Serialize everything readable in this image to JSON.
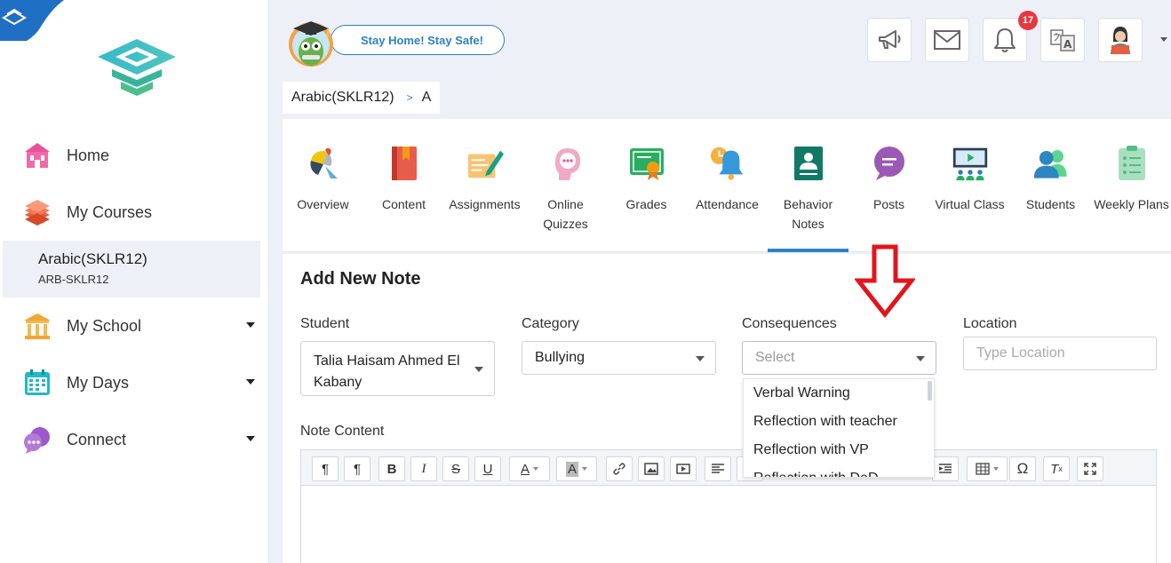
{
  "sidebar": {
    "nav": [
      {
        "label": "Home",
        "icon": "home-icon"
      },
      {
        "label": "My Courses",
        "icon": "courses-icon"
      },
      {
        "label": "My School",
        "icon": "school-icon"
      },
      {
        "label": "My Days",
        "icon": "calendar-icon"
      },
      {
        "label": "Connect",
        "icon": "connect-icon"
      }
    ],
    "active_course": {
      "name": "Arabic(SKLR12)",
      "code": "ARB-SKLR12"
    }
  },
  "header": {
    "banner": "Stay Home! Stay Safe!",
    "notification_count": "17"
  },
  "breadcrumb": {
    "course": "Arabic(SKLR12)",
    "separator": ">",
    "section": "A"
  },
  "tabs": [
    {
      "label": "Overview",
      "icon": "overview-icon"
    },
    {
      "label": "Content",
      "icon": "book-icon"
    },
    {
      "label": "Assignments",
      "icon": "assignment-icon"
    },
    {
      "label": "Online\nQuizzes",
      "icon": "quiz-icon"
    },
    {
      "label": "Grades",
      "icon": "certificate-icon"
    },
    {
      "label": "Attendance",
      "icon": "bell-clock-icon"
    },
    {
      "label": "Behavior\nNotes",
      "icon": "behavior-icon",
      "active": true
    },
    {
      "label": "Posts",
      "icon": "chat-icon"
    },
    {
      "label": "Virtual Class",
      "icon": "virtual-class-icon"
    },
    {
      "label": "Students",
      "icon": "students-icon"
    },
    {
      "label": "Weekly Plans",
      "icon": "checklist-icon"
    }
  ],
  "form": {
    "title": "Add New Note",
    "student": {
      "label": "Student",
      "value": "Talia Haisam Ahmed El Kabany"
    },
    "category": {
      "label": "Category",
      "value": "Bullying"
    },
    "consequences": {
      "label": "Consequences",
      "placeholder": "Select",
      "options": [
        "Verbal Warning",
        "Reflection with teacher",
        "Reflection with VP",
        "Reflection with DeD"
      ]
    },
    "location": {
      "label": "Location",
      "placeholder": "Type Location"
    },
    "note_content": {
      "label": "Note Content"
    }
  },
  "colors": {
    "accent": "#2f80c8",
    "badge": "#e53940",
    "arrow": "#e3141b"
  }
}
